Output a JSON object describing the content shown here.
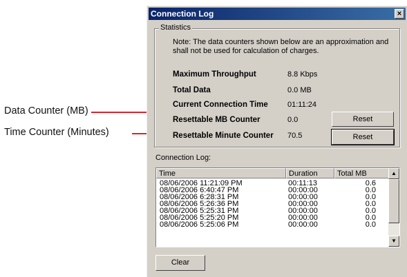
{
  "callouts": {
    "data_counter": "Data Counter (MB)",
    "time_counter": "Time Counter (Minutes)"
  },
  "dialog": {
    "title": "Connection Log",
    "close_glyph": "×",
    "statistics": {
      "group_label": "Statistics",
      "note": "Note: The data counters shown below are an approximation and shall not be used for calculation of charges.",
      "rows": [
        {
          "label": "Maximum Throughput",
          "value": "8.8 Kbps"
        },
        {
          "label": "Total Data",
          "value": "0.0 MB"
        },
        {
          "label": "Current Connection Time",
          "value": "01:11:24"
        },
        {
          "label": "Resettable MB Counter",
          "value": "0.0"
        },
        {
          "label": "Resettable Minute Counter",
          "value": "70.5"
        }
      ],
      "reset_mb_label": "Reset",
      "reset_minute_label": "Reset"
    },
    "log": {
      "label": "Connection Log:",
      "columns": [
        "Time",
        "Duration",
        "Total MB"
      ],
      "rows": [
        {
          "time": "08/06/2006 11:21:09 PM",
          "duration": "00:11:13",
          "total": "0.6"
        },
        {
          "time": "08/06/2006 6:40:47 PM",
          "duration": "00:00:00",
          "total": "0.0"
        },
        {
          "time": "08/06/2006 6:28:31 PM",
          "duration": "00:00:00",
          "total": "0.0"
        },
        {
          "time": "08/06/2006 5:26:36 PM",
          "duration": "00:00:00",
          "total": "0.0"
        },
        {
          "time": "08/06/2006 5:25:31 PM",
          "duration": "00:00:00",
          "total": "0.0"
        },
        {
          "time": "08/06/2006 5:25:20 PM",
          "duration": "00:00:00",
          "total": "0.0"
        },
        {
          "time": "08/06/2006 5:25:06 PM",
          "duration": "00:00:00",
          "total": "0.0"
        }
      ],
      "scroll_up_glyph": "▲",
      "scroll_down_glyph": "▼"
    },
    "clear_label": "Clear"
  },
  "colors": {
    "callout_line": "#d9232a",
    "titlebar_start": "#0a246a",
    "titlebar_end": "#3a6ea5"
  }
}
